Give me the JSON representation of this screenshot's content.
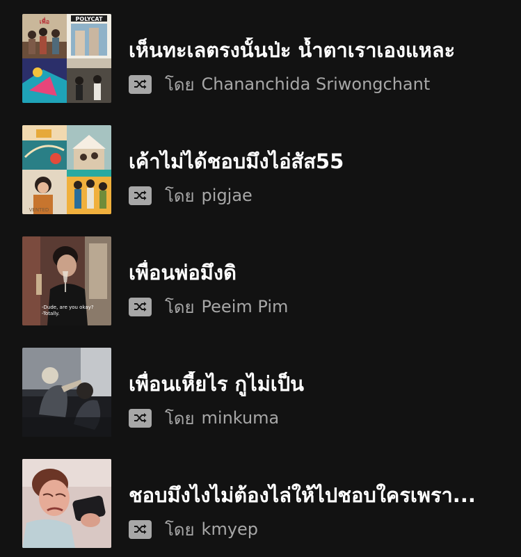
{
  "playlists": [
    {
      "title": "เห็นทะเลตรงนั้นป่ะ น้ำตาเราเองแหละ",
      "by_label": "โดย",
      "owner": "Chananchida Sriwongchant",
      "cover": "four-album-grid-1",
      "mode_icon": "shuffle-icon"
    },
    {
      "title": "เค้าไม่ได้ชอบมึงไอ่สัส55",
      "by_label": "โดย",
      "owner": "pigjae",
      "cover": "four-album-grid-2",
      "mode_icon": "shuffle-icon"
    },
    {
      "title": "เพื่อนพ่อมึงดิ",
      "by_label": "โดย",
      "owner": "Peeim Pim",
      "cover": "tv-still-wine-glass",
      "cover_caption_lines": [
        "-Dude, are you okay?",
        "-Totally."
      ],
      "mode_icon": "shuffle-icon"
    },
    {
      "title": "เพื่อนเหี้ยไร กูไม่เป็น",
      "by_label": "โดย",
      "owner": "minkuma",
      "cover": "dim-room-photo",
      "mode_icon": "shuffle-icon"
    },
    {
      "title": "ชอบมึงไงไม่ต้องไล่ให้ไปชอบใครเพรา...",
      "by_label": "โดย",
      "owner": "kmyep",
      "cover": "crying-phone-photo",
      "mode_icon": "shuffle-icon"
    }
  ],
  "colors": {
    "background": "#121212",
    "title": "#ffffff",
    "secondary": "#a7a7a7"
  }
}
